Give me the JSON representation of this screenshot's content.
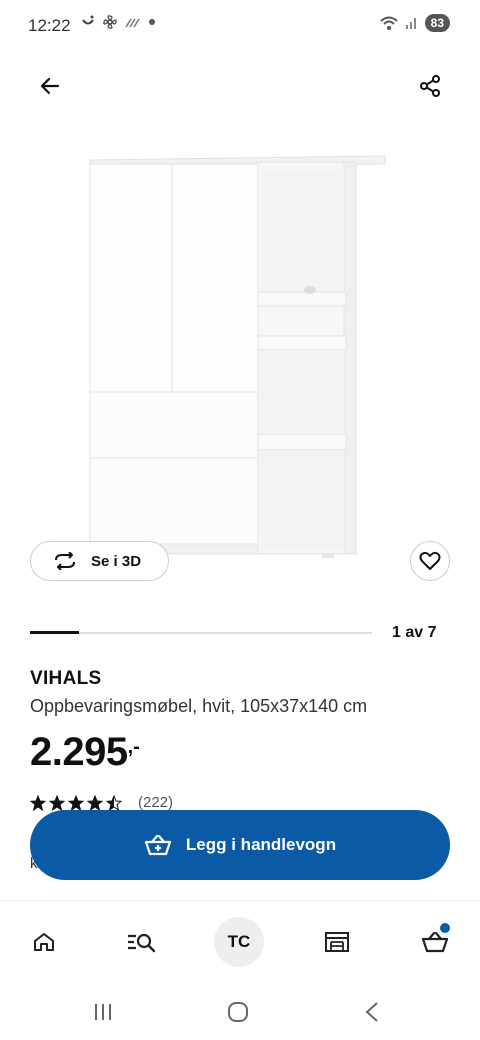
{
  "status_bar": {
    "time": "12:22",
    "battery": "83",
    "left_icons": [
      "smile-notification-icon",
      "fan-icon",
      "missed-call-icon",
      "dot-icon"
    ],
    "right_icons": [
      "wifi-icon",
      "signal-icon"
    ]
  },
  "top_nav": {
    "back_icon": "arrow-left-icon",
    "share_icon": "share-icon"
  },
  "media": {
    "view3d_label": "Se i 3D",
    "view3d_icon": "rotate-3d-icon",
    "favorite_icon": "heart-icon",
    "counter": "1 av 7",
    "progress_fraction": 0.143
  },
  "product": {
    "name": "VIHALS",
    "description": "Oppbevaringsmøbel, hvit, 105x37x140 cm",
    "price": "2.295",
    "price_suffix": ",-",
    "rating_value": 4.5,
    "rating_max": 5,
    "rating_count": "(222)",
    "partial_text": "k"
  },
  "cart_button": {
    "label": "Legg i handlevogn",
    "icon": "basket-plus-icon"
  },
  "bottom_nav": {
    "items": [
      {
        "name": "home",
        "icon": "home-icon"
      },
      {
        "name": "search",
        "icon": "search-list-icon"
      },
      {
        "name": "profile",
        "label": "TC"
      },
      {
        "name": "store",
        "icon": "store-icon"
      },
      {
        "name": "cart",
        "icon": "basket-icon"
      }
    ]
  },
  "colors": {
    "accent": "#0a5aa5",
    "text": "#111111",
    "muted": "#555555"
  }
}
